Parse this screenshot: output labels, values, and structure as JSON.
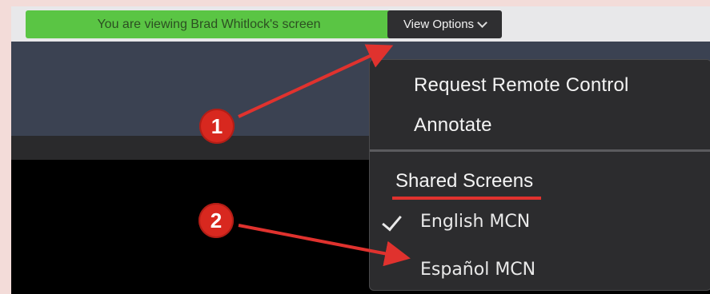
{
  "share_bar": {
    "banner_text": "You are viewing Brad Whitlock's screen",
    "view_options_label": "View Options"
  },
  "menu": {
    "items": [
      {
        "label": "Request Remote Control"
      },
      {
        "label": "Annotate"
      }
    ],
    "section_title": "Shared Screens",
    "screens": [
      {
        "label": "English MCN",
        "checked": true
      },
      {
        "label": "Español MCN",
        "checked": false
      }
    ]
  },
  "callouts": [
    {
      "label": "1"
    },
    {
      "label": "2"
    }
  ],
  "colors": {
    "banner_green": "#5ac544",
    "callout_red": "#d8281f",
    "menu_bg": "#2c2c2e"
  },
  "icons": {
    "dropdown": "chevron-down-icon",
    "selected": "checkmark-icon"
  }
}
